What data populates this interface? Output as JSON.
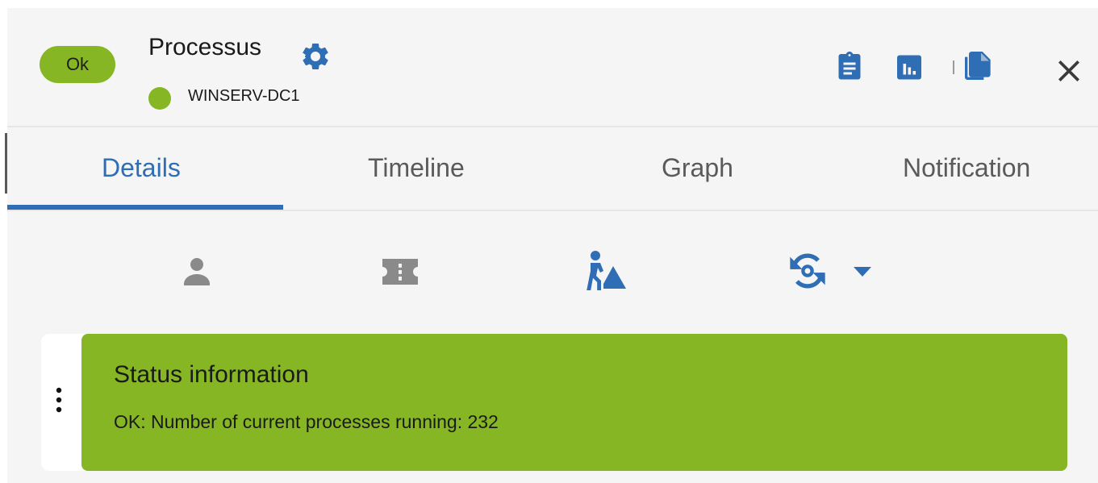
{
  "header": {
    "status": "Ok",
    "title": "Processus",
    "host": "WINSERV-DC1",
    "icons": [
      "settings-gear-icon",
      "clipboard-icon",
      "bar-chart-icon",
      "copy-icon",
      "close-icon"
    ]
  },
  "tabs": [
    {
      "label": "Details",
      "active": true
    },
    {
      "label": "Timeline",
      "active": false
    },
    {
      "label": "Graph",
      "active": false
    },
    {
      "label": "Notification",
      "active": false
    }
  ],
  "toolbar": {
    "icons": [
      "person-icon",
      "ticket-icon",
      "acknowledge-worker-icon",
      "check-refresh-icon",
      "dropdown-arrow-icon"
    ]
  },
  "status_card": {
    "title": "Status information",
    "text": "OK: Number of current processes running: 232"
  },
  "colors": {
    "ok_green": "#86b624",
    "accent_blue": "#2f6db5",
    "inactive_icon": "#8a8a8a"
  }
}
